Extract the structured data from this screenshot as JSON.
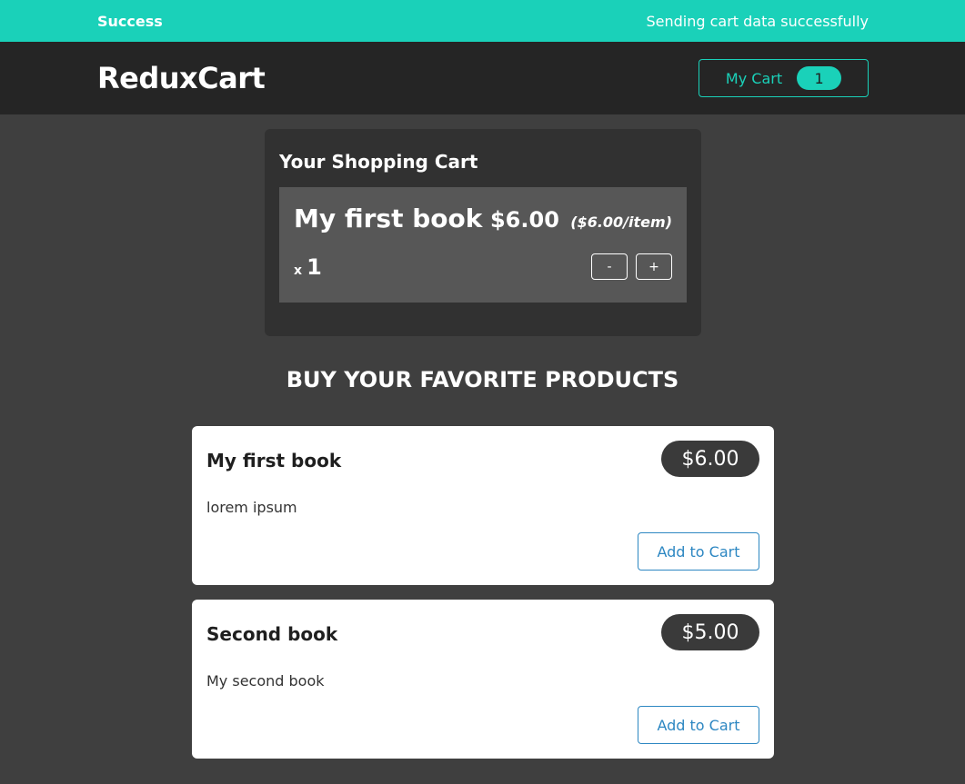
{
  "notification": {
    "title": "Success",
    "message": "Sending cart data successfully"
  },
  "header": {
    "logo": "ReduxCart",
    "cart_button_label": "My Cart",
    "cart_count": "1"
  },
  "cart": {
    "title": "Your Shopping Cart",
    "items": [
      {
        "name": "My first book",
        "total": "$6.00",
        "per_item": "($6.00/item)",
        "qty_prefix": "x",
        "qty": "1",
        "minus_label": "-",
        "plus_label": "+"
      }
    ]
  },
  "products_section": {
    "title": "BUY YOUR FAVORITE PRODUCTS",
    "products": [
      {
        "name": "My first book",
        "price": "$6.00",
        "description": "lorem ipsum",
        "button_label": "Add to Cart"
      },
      {
        "name": "Second book",
        "price": "$5.00",
        "description": "My second book",
        "button_label": "Add to Cart"
      }
    ]
  },
  "colors": {
    "accent": "#1ad1b9",
    "header_bg": "#252525",
    "page_bg": "#3f3f3f",
    "link_blue": "#2d87c2"
  }
}
